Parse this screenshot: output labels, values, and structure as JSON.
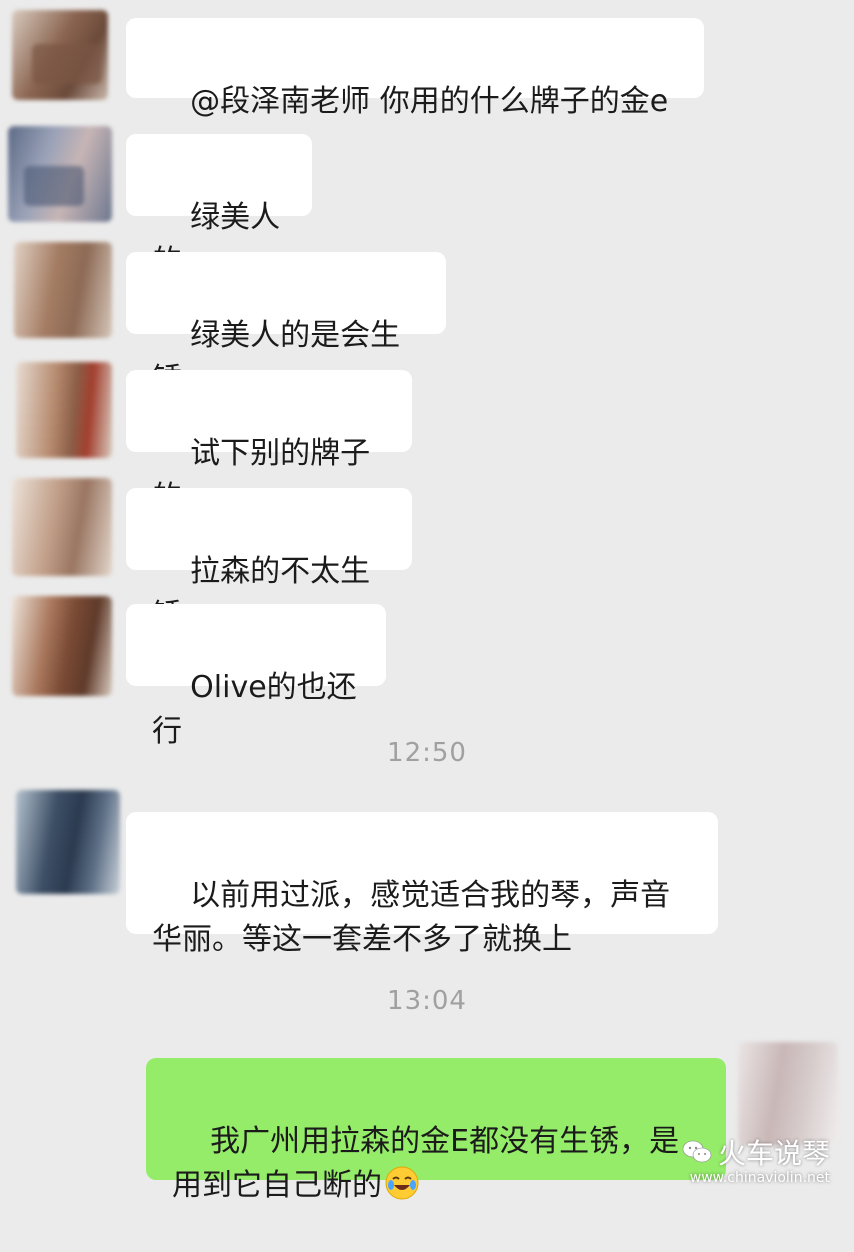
{
  "messages": [
    {
      "side": "left",
      "text": "@段泽南老师 你用的什么牌子的金e"
    },
    {
      "side": "left",
      "text": "绿美人的"
    },
    {
      "side": "left",
      "text": "绿美人的是会生锈"
    },
    {
      "side": "left",
      "text": "试下别的牌子的"
    },
    {
      "side": "left",
      "text": "拉森的不太生锈"
    },
    {
      "side": "left",
      "text": "Olive的也还行"
    },
    {
      "side": "left",
      "text": "以前用过派，感觉适合我的琴，声音\n华丽。等这一套差不多了就换上"
    },
    {
      "side": "right",
      "text": "我广州用拉森的金E都没有生锈，是\n用到它自己断的",
      "emoji": "laughing-crying-face-icon"
    }
  ],
  "timestamps": [
    "12:50",
    "13:04"
  ],
  "watermark": {
    "title": "火车说琴",
    "url": "www.chinaviolin.net"
  },
  "colors": {
    "background": "#ebebeb",
    "incoming_bubble": "#ffffff",
    "outgoing_bubble": "#95ec69",
    "timestamp_text": "#a0a0a0",
    "message_text": "#1b1b1b"
  }
}
